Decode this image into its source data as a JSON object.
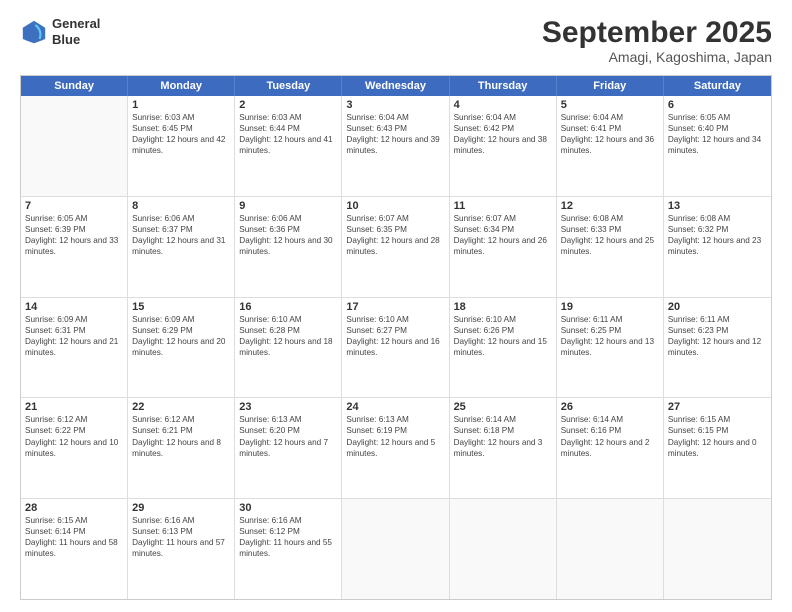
{
  "header": {
    "logo_line1": "General",
    "logo_line2": "Blue",
    "month": "September 2025",
    "location": "Amagi, Kagoshima, Japan"
  },
  "days_of_week": [
    "Sunday",
    "Monday",
    "Tuesday",
    "Wednesday",
    "Thursday",
    "Friday",
    "Saturday"
  ],
  "weeks": [
    [
      {
        "day": null
      },
      {
        "day": "1",
        "sunrise": "6:03 AM",
        "sunset": "6:45 PM",
        "daylight": "12 hours and 42 minutes."
      },
      {
        "day": "2",
        "sunrise": "6:03 AM",
        "sunset": "6:44 PM",
        "daylight": "12 hours and 41 minutes."
      },
      {
        "day": "3",
        "sunrise": "6:04 AM",
        "sunset": "6:43 PM",
        "daylight": "12 hours and 39 minutes."
      },
      {
        "day": "4",
        "sunrise": "6:04 AM",
        "sunset": "6:42 PM",
        "daylight": "12 hours and 38 minutes."
      },
      {
        "day": "5",
        "sunrise": "6:04 AM",
        "sunset": "6:41 PM",
        "daylight": "12 hours and 36 minutes."
      },
      {
        "day": "6",
        "sunrise": "6:05 AM",
        "sunset": "6:40 PM",
        "daylight": "12 hours and 34 minutes."
      }
    ],
    [
      {
        "day": "7",
        "sunrise": "6:05 AM",
        "sunset": "6:39 PM",
        "daylight": "12 hours and 33 minutes."
      },
      {
        "day": "8",
        "sunrise": "6:06 AM",
        "sunset": "6:37 PM",
        "daylight": "12 hours and 31 minutes."
      },
      {
        "day": "9",
        "sunrise": "6:06 AM",
        "sunset": "6:36 PM",
        "daylight": "12 hours and 30 minutes."
      },
      {
        "day": "10",
        "sunrise": "6:07 AM",
        "sunset": "6:35 PM",
        "daylight": "12 hours and 28 minutes."
      },
      {
        "day": "11",
        "sunrise": "6:07 AM",
        "sunset": "6:34 PM",
        "daylight": "12 hours and 26 minutes."
      },
      {
        "day": "12",
        "sunrise": "6:08 AM",
        "sunset": "6:33 PM",
        "daylight": "12 hours and 25 minutes."
      },
      {
        "day": "13",
        "sunrise": "6:08 AM",
        "sunset": "6:32 PM",
        "daylight": "12 hours and 23 minutes."
      }
    ],
    [
      {
        "day": "14",
        "sunrise": "6:09 AM",
        "sunset": "6:31 PM",
        "daylight": "12 hours and 21 minutes."
      },
      {
        "day": "15",
        "sunrise": "6:09 AM",
        "sunset": "6:29 PM",
        "daylight": "12 hours and 20 minutes."
      },
      {
        "day": "16",
        "sunrise": "6:10 AM",
        "sunset": "6:28 PM",
        "daylight": "12 hours and 18 minutes."
      },
      {
        "day": "17",
        "sunrise": "6:10 AM",
        "sunset": "6:27 PM",
        "daylight": "12 hours and 16 minutes."
      },
      {
        "day": "18",
        "sunrise": "6:10 AM",
        "sunset": "6:26 PM",
        "daylight": "12 hours and 15 minutes."
      },
      {
        "day": "19",
        "sunrise": "6:11 AM",
        "sunset": "6:25 PM",
        "daylight": "12 hours and 13 minutes."
      },
      {
        "day": "20",
        "sunrise": "6:11 AM",
        "sunset": "6:23 PM",
        "daylight": "12 hours and 12 minutes."
      }
    ],
    [
      {
        "day": "21",
        "sunrise": "6:12 AM",
        "sunset": "6:22 PM",
        "daylight": "12 hours and 10 minutes."
      },
      {
        "day": "22",
        "sunrise": "6:12 AM",
        "sunset": "6:21 PM",
        "daylight": "12 hours and 8 minutes."
      },
      {
        "day": "23",
        "sunrise": "6:13 AM",
        "sunset": "6:20 PM",
        "daylight": "12 hours and 7 minutes."
      },
      {
        "day": "24",
        "sunrise": "6:13 AM",
        "sunset": "6:19 PM",
        "daylight": "12 hours and 5 minutes."
      },
      {
        "day": "25",
        "sunrise": "6:14 AM",
        "sunset": "6:18 PM",
        "daylight": "12 hours and 3 minutes."
      },
      {
        "day": "26",
        "sunrise": "6:14 AM",
        "sunset": "6:16 PM",
        "daylight": "12 hours and 2 minutes."
      },
      {
        "day": "27",
        "sunrise": "6:15 AM",
        "sunset": "6:15 PM",
        "daylight": "12 hours and 0 minutes."
      }
    ],
    [
      {
        "day": "28",
        "sunrise": "6:15 AM",
        "sunset": "6:14 PM",
        "daylight": "11 hours and 58 minutes."
      },
      {
        "day": "29",
        "sunrise": "6:16 AM",
        "sunset": "6:13 PM",
        "daylight": "11 hours and 57 minutes."
      },
      {
        "day": "30",
        "sunrise": "6:16 AM",
        "sunset": "6:12 PM",
        "daylight": "11 hours and 55 minutes."
      },
      {
        "day": null
      },
      {
        "day": null
      },
      {
        "day": null
      },
      {
        "day": null
      }
    ]
  ],
  "labels": {
    "sunrise_prefix": "Sunrise: ",
    "sunset_prefix": "Sunset: ",
    "daylight_prefix": "Daylight: "
  }
}
